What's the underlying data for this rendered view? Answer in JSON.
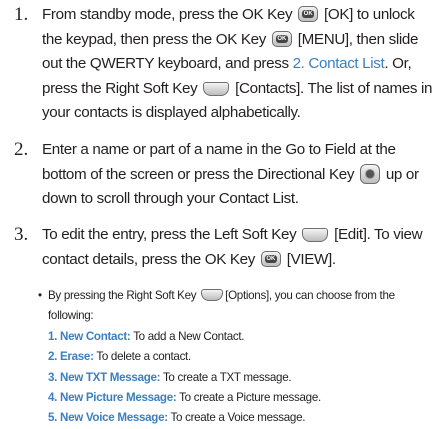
{
  "steps": [
    {
      "number": "1.",
      "parts": [
        "From standby mode, press the OK Key",
        "[OK] to unlock the keypad, then press the OK Key",
        "[MENU], then slide out the QWERTY keyboard, and press",
        "2. Contact List",
        ". Or, press the Right Soft Key",
        "[Contacts]. The list of names in your contacts is displayed alphabetically."
      ]
    },
    {
      "number": "2.",
      "parts": [
        "Enter a name or part of a name in the Go to Field at the bottom of the screen or press the Directional Key",
        "up or down to scroll through your Contact List."
      ]
    },
    {
      "number": "3.",
      "parts": [
        "To edit the entry, press the Left Soft Key",
        "[Edit]. To view contact details, press the OK Key",
        "[VIEW]."
      ]
    }
  ],
  "sub": {
    "bullet": "•",
    "intro_a": "By pressing the Right Soft Key",
    "intro_b": "[Options], you can choose from the following:",
    "options": [
      {
        "num": "1. New Contact:",
        "desc": "To add a New Contact."
      },
      {
        "num": "2. Erase:",
        "desc": "To delete a contact."
      },
      {
        "num": "3. New TXT Message:",
        "desc": "To create a TXT message."
      },
      {
        "num": "4. New Picture Message:",
        "desc": "To create a Picture message."
      },
      {
        "num": "5. New Voice Message:",
        "desc": "To create a Voice message."
      }
    ]
  },
  "icons": {
    "ok_key_label": "OK"
  }
}
